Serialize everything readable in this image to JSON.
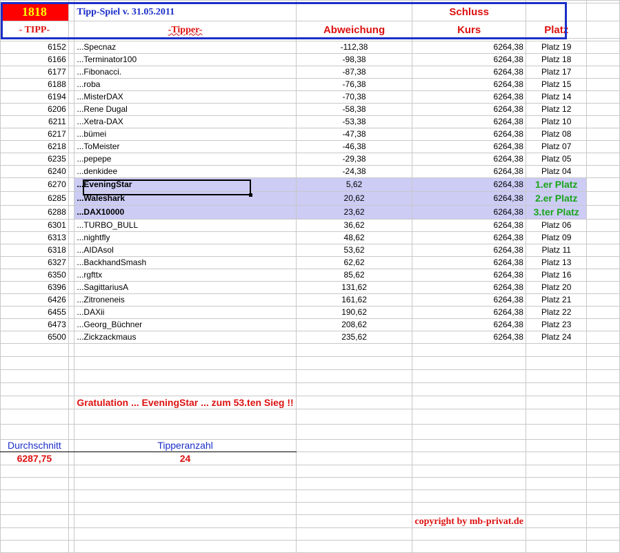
{
  "header": {
    "id_number": "1818",
    "title": "Tipp-Spiel v. 31.05.2011",
    "schluss": "Schluss",
    "col_tipp": "- TIPP-",
    "col_tipper": "-Tipper-",
    "col_abweichung": "Abweichung",
    "col_kurs": "Kurs",
    "col_platz": "Platz"
  },
  "rows": [
    {
      "tipp": "6152",
      "name": "...Specnaz",
      "abw": "-112,38",
      "kurs": "6264,38",
      "platz": "Platz 19"
    },
    {
      "tipp": "6166",
      "name": "...Terminator100",
      "abw": "-98,38",
      "kurs": "6264,38",
      "platz": "Platz 18"
    },
    {
      "tipp": "6177",
      "name": "...Fibonacci.",
      "abw": "-87,38",
      "kurs": "6264,38",
      "platz": "Platz 17"
    },
    {
      "tipp": "6188",
      "name": "...roba",
      "abw": "-76,38",
      "kurs": "6264,38",
      "platz": "Platz 15"
    },
    {
      "tipp": "6194",
      "name": "...MisterDAX",
      "abw": "-70,38",
      "kurs": "6264,38",
      "platz": "Platz 14"
    },
    {
      "tipp": "6206",
      "name": "...Rene Dugal",
      "abw": "-58,38",
      "kurs": "6264,38",
      "platz": "Platz 12"
    },
    {
      "tipp": "6211",
      "name": "...Xetra-DAX",
      "abw": "-53,38",
      "kurs": "6264,38",
      "platz": "Platz 10"
    },
    {
      "tipp": "6217",
      "name": "...bümei",
      "abw": "-47,38",
      "kurs": "6264,38",
      "platz": "Platz 08"
    },
    {
      "tipp": "6218",
      "name": "...ToMeister",
      "abw": "-46,38",
      "kurs": "6264,38",
      "platz": "Platz 07"
    },
    {
      "tipp": "6235",
      "name": "...pepepe",
      "abw": "-29,38",
      "kurs": "6264,38",
      "platz": "Platz 05"
    },
    {
      "tipp": "6240",
      "name": "...denkidee",
      "abw": "-24,38",
      "kurs": "6264,38",
      "platz": "Platz 04"
    },
    {
      "tipp": "6270",
      "name": "...EveningStar",
      "abw": "5,62",
      "kurs": "6264,38",
      "platz": "1.er Platz",
      "winner": true
    },
    {
      "tipp": "6285",
      "name": "...Waleshark",
      "abw": "20,62",
      "kurs": "6264,38",
      "platz": "2.er Platz",
      "winner": true
    },
    {
      "tipp": "6288",
      "name": "...DAX10000",
      "abw": "23,62",
      "kurs": "6264,38",
      "platz": "3.ter Platz",
      "winner": true
    },
    {
      "tipp": "6301",
      "name": "...TURBO_BULL",
      "abw": "36,62",
      "kurs": "6264,38",
      "platz": "Platz 06"
    },
    {
      "tipp": "6313",
      "name": "...nightfly",
      "abw": "48,62",
      "kurs": "6264,38",
      "platz": "Platz 09"
    },
    {
      "tipp": "6318",
      "name": "...AIDAsol",
      "abw": "53,62",
      "kurs": "6264,38",
      "platz": "Platz 11"
    },
    {
      "tipp": "6327",
      "name": "...BackhandSmash",
      "abw": "62,62",
      "kurs": "6264,38",
      "platz": "Platz 13"
    },
    {
      "tipp": "6350",
      "name": "...rgfttx",
      "abw": "85,62",
      "kurs": "6264,38",
      "platz": "Platz 16"
    },
    {
      "tipp": "6396",
      "name": "...SagittariusA",
      "abw": "131,62",
      "kurs": "6264,38",
      "platz": "Platz 20"
    },
    {
      "tipp": "6426",
      "name": "...Zitroneneis",
      "abw": "161,62",
      "kurs": "6264,38",
      "platz": "Platz 21"
    },
    {
      "tipp": "6455",
      "name": "...DAXii",
      "abw": "190,62",
      "kurs": "6264,38",
      "platz": "Platz 22"
    },
    {
      "tipp": "6473",
      "name": "...Georg_Büchner",
      "abw": "208,62",
      "kurs": "6264,38",
      "platz": "Platz 23"
    },
    {
      "tipp": "6500",
      "name": "...Zickzackmaus",
      "abw": "235,62",
      "kurs": "6264,38",
      "platz": "Platz 24"
    }
  ],
  "footer": {
    "gratulation": "Gratulation   ...   EveningStar ... zum   53.ten Sieg  !!",
    "durchschnitt_label": "Durchschnitt",
    "durchschnitt_value": "6287,75",
    "tipperanzahl_label": "Tipperanzahl",
    "tipperanzahl_value": "24",
    "copyright": "copyright by mb-privat.de"
  },
  "colors": {
    "accent_red": "#dd1111",
    "border_blue": "#1a2ec8",
    "highlight": "#ccccf5",
    "winner_green": "#1aa51a",
    "id_bg": "#ff0000",
    "id_text": "#ffff00"
  }
}
